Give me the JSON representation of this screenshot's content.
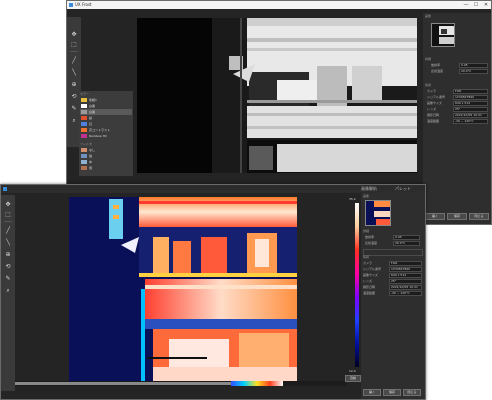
{
  "back_window": {
    "title": "UX Frost",
    "controls": {
      "minimize": "—",
      "maximize": "☐",
      "close": "✕"
    },
    "toolbar": [
      "pointer-tool",
      "crop-tool",
      "line-tool",
      "line-tool",
      "zoom-tool",
      "rotate-tool",
      "brush-tool",
      "search-tool"
    ],
    "list_header_1": "カラー",
    "palette_items": [
      {
        "label": "色相1",
        "color": "#e8c040"
      },
      {
        "label": "白黒",
        "color": "#ffffff"
      },
      {
        "label": "白黒",
        "color": "#9a9a9a"
      },
      {
        "label": "鉄",
        "color": "#e05030"
      },
      {
        "label": "虹",
        "color": "#5080e0"
      },
      {
        "label": "高コントラスト",
        "color": "#f07030"
      },
      {
        "label": "Rainbow HC",
        "color": "#c03090"
      }
    ],
    "list_header_2": "フィルタ",
    "filter_items": [
      {
        "label": "なし",
        "color": "#d09070"
      },
      {
        "label": "強",
        "color": "#7090c0"
      },
      {
        "label": "中",
        "color": "#90b0d0"
      },
      {
        "label": "弱",
        "color": "#b07050"
      }
    ],
    "panel_top_label": "画像",
    "details_header": "詳細",
    "fields_a": [
      {
        "label": "放射率",
        "value": "0.95"
      },
      {
        "label": "反射温度",
        "value": "20.0°C"
      }
    ],
    "fields_b_header": "情報",
    "fields_b": [
      {
        "label": "カメラ",
        "value": "FLIR"
      },
      {
        "label": "シリアル番号",
        "value": "1234567890"
      },
      {
        "label": "画像サイズ",
        "value": "640 x 512"
      },
      {
        "label": "レンズ",
        "value": "25°"
      },
      {
        "label": "撮影日時",
        "value": "2021/10/05 10:21"
      },
      {
        "label": "温度範囲",
        "value": "-20 ~ 120°C"
      }
    ],
    "buttons": [
      "開く",
      "保存",
      "閉じる"
    ]
  },
  "front_window": {
    "title": "画像解析",
    "top_right_label": "パレット",
    "controls": {
      "minimize": "—",
      "maximize": "☐",
      "close": "✕"
    },
    "toolbar": [
      "pointer-tool",
      "crop-tool",
      "line-tool",
      "line-tool",
      "zoom-tool",
      "rotate-tool",
      "brush-tool",
      "search-tool"
    ],
    "scale_top": "35.2",
    "scale_bottom": "12.4",
    "range_label": "自動",
    "panel_top_label": "画像",
    "details_header": "詳細",
    "fields_a": [
      {
        "label": "放射率",
        "value": "0.95"
      },
      {
        "label": "反射温度",
        "value": "20.0°C"
      }
    ],
    "fields_b_header": "情報",
    "fields_b": [
      {
        "label": "カメラ",
        "value": "FLIR"
      },
      {
        "label": "シリアル番号",
        "value": "1234567890"
      },
      {
        "label": "画像サイズ",
        "value": "640 x 512"
      },
      {
        "label": "レンズ",
        "value": "25°"
      },
      {
        "label": "撮影日時",
        "value": "2021/10/05 10:21"
      },
      {
        "label": "温度範囲",
        "value": "-20 ~ 120°C"
      }
    ],
    "buttons": [
      "開く",
      "保存",
      "閉じる"
    ],
    "scroll_position": 0.55
  }
}
